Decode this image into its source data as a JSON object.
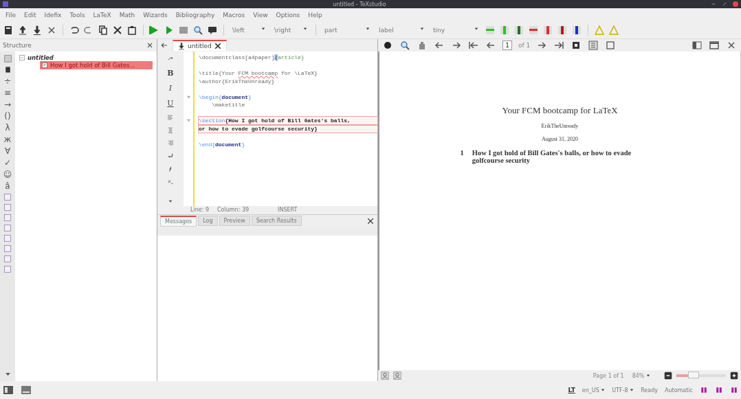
{
  "window": {
    "title": "untitled - TeXstudio"
  },
  "menu": [
    "File",
    "Edit",
    "Idefix",
    "Tools",
    "LaTeX",
    "Math",
    "Wizards",
    "Bibliography",
    "Macros",
    "View",
    "Options",
    "Help"
  ],
  "toolbar": {
    "dropdowns_left": [
      "\\left",
      "\\right"
    ],
    "dropdowns_right": [
      "part",
      "label",
      "tiny"
    ]
  },
  "structure": {
    "title": "Structure",
    "tree": [
      {
        "label": "untitled",
        "selected": false,
        "children": [
          {
            "label": "How I got hold of Bill Gates...",
            "selected": true
          }
        ]
      }
    ]
  },
  "symbol_bar": [
    "÷",
    "≡",
    "→",
    "()",
    "λ",
    "ж",
    "∀",
    "✓",
    "☺",
    "â"
  ],
  "editor": {
    "tabs": [
      {
        "label": "untitled",
        "selected": true
      }
    ],
    "format_bar": [
      "B",
      "I",
      "U"
    ],
    "lines": [
      {
        "kind": "code",
        "fold": false,
        "highlight": false,
        "segments": [
          {
            "kind": "cmd",
            "text": "\\documentclass[a4paper]"
          },
          {
            "kind": "bracket",
            "text": "{"
          },
          {
            "kind": "arg",
            "text": "article}"
          }
        ]
      },
      {
        "kind": "blank"
      },
      {
        "kind": "code",
        "fold": false,
        "highlight": false,
        "segments": [
          {
            "kind": "cmd",
            "text": "\\title{Your "
          },
          {
            "kind": "spell",
            "text": "FCM bootcamp"
          },
          {
            "kind": "cmd",
            "text": " for \\LaTeX}"
          }
        ]
      },
      {
        "kind": "code",
        "fold": false,
        "highlight": false,
        "segments": [
          {
            "kind": "cmd",
            "text": "\\author{ErikTheUnready}"
          }
        ]
      },
      {
        "kind": "blank"
      },
      {
        "kind": "code",
        "fold": true,
        "highlight": false,
        "segments": [
          {
            "kind": "env",
            "text": "\\begin{"
          },
          {
            "kind": "envname",
            "text": "document"
          },
          {
            "kind": "env",
            "text": "}"
          }
        ]
      },
      {
        "kind": "code",
        "fold": false,
        "highlight": false,
        "segments": [
          {
            "kind": "cmd",
            "text": "    \\maketitle"
          }
        ]
      },
      {
        "kind": "blank"
      },
      {
        "kind": "code",
        "fold": true,
        "highlight": true,
        "segments": [
          {
            "kind": "env",
            "text": "\\section"
          },
          {
            "kind": "bold",
            "text": "{How I got hold of Bill Gates's balls,"
          }
        ]
      },
      {
        "kind": "code",
        "fold": false,
        "highlight": true,
        "segments": [
          {
            "kind": "bold",
            "text": "or how to evade golfcourse security}"
          }
        ]
      },
      {
        "kind": "blank"
      },
      {
        "kind": "code",
        "fold": false,
        "highlight": false,
        "segments": [
          {
            "kind": "env",
            "text": "\\end{"
          },
          {
            "kind": "envname",
            "text": "document"
          },
          {
            "kind": "env",
            "text": "}"
          }
        ]
      }
    ],
    "status": {
      "line": "Line: 9",
      "column": "Column: 39",
      "mode": "INSERT"
    }
  },
  "messages": {
    "tabs": [
      {
        "label": "Messages",
        "selected": true
      },
      {
        "label": "Log",
        "selected": false
      },
      {
        "label": "Preview",
        "selected": false
      },
      {
        "label": "Search Results",
        "selected": false
      }
    ]
  },
  "pdf": {
    "page_field": "1",
    "page_of": "of 1",
    "document": {
      "title": "Your FCM bootcamp for LaTeX",
      "author": "ErikTheUnready",
      "date": "August 31, 2020",
      "section_number": "1",
      "section_title": "How I got hold of Bill Gates's balls, or how to evade golfcourse security"
    },
    "page_info": "Page 1 of 1",
    "zoom": "84%",
    "zoom_level": {
      "level": 0.35
    }
  },
  "status_bar": {
    "grammar": "LT",
    "language": "en_US",
    "encoding": "UTF-8",
    "state": "Ready",
    "compile_mode": "Automatic"
  }
}
